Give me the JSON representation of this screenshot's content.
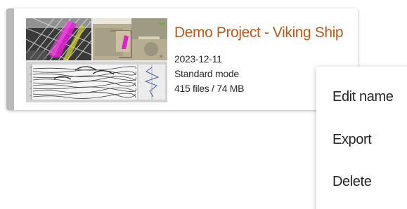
{
  "project": {
    "title": "Demo Project - Viking Ship",
    "date": "2023-12-11",
    "mode": "Standard mode",
    "files": "415 files / 74 MB",
    "title_color": "#c0581a"
  },
  "context_menu": {
    "items": [
      {
        "label": "Edit name"
      },
      {
        "label": "Export"
      },
      {
        "label": "Delete"
      }
    ]
  }
}
